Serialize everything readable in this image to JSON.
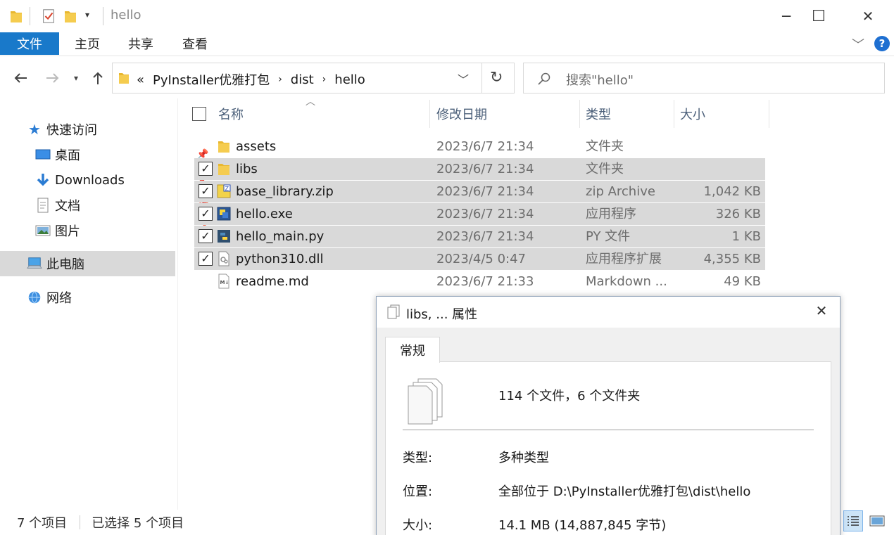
{
  "window": {
    "title": "hello",
    "controls": {
      "minimize": "─",
      "maximize": "☐",
      "close": "✕"
    }
  },
  "ribbon": {
    "tabs": [
      "文件",
      "主页",
      "共享",
      "查看"
    ],
    "help": "?"
  },
  "address": {
    "breadcrumb_prefix": "«",
    "crumbs": [
      "PyInstaller优雅打包",
      "dist",
      "hello"
    ],
    "search_placeholder": "搜索\"hello\""
  },
  "sidebar": {
    "quick_access": "快速访问",
    "items": [
      {
        "label": "桌面",
        "pinned": true
      },
      {
        "label": "Downloads",
        "pinned": true
      },
      {
        "label": "文档",
        "pinned": true
      },
      {
        "label": "图片",
        "pinned": true
      }
    ],
    "this_pc": "此电脑",
    "network": "网络"
  },
  "columns": {
    "name": "名称",
    "modified": "修改日期",
    "type": "类型",
    "size": "大小"
  },
  "files": [
    {
      "name": "assets",
      "modified": "2023/6/7 21:34",
      "type": "文件夹",
      "size": "",
      "selected": false,
      "icon": "folder-icon"
    },
    {
      "name": "libs",
      "modified": "2023/6/7 21:34",
      "type": "文件夹",
      "size": "",
      "selected": true,
      "icon": "folder-icon"
    },
    {
      "name": "base_library.zip",
      "modified": "2023/6/7 21:34",
      "type": "zip Archive",
      "size": "1,042 KB",
      "selected": true,
      "icon": "zip-icon"
    },
    {
      "name": "hello.exe",
      "modified": "2023/6/7 21:34",
      "type": "应用程序",
      "size": "326 KB",
      "selected": true,
      "icon": "exe-icon"
    },
    {
      "name": "hello_main.py",
      "modified": "2023/6/7 21:34",
      "type": "PY 文件",
      "size": "1 KB",
      "selected": true,
      "icon": "python-icon"
    },
    {
      "name": "python310.dll",
      "modified": "2023/4/5 0:47",
      "type": "应用程序扩展",
      "size": "4,355 KB",
      "selected": true,
      "icon": "dll-icon"
    },
    {
      "name": "readme.md",
      "modified": "2023/6/7 21:33",
      "type": "Markdown ...",
      "size": "49 KB",
      "selected": false,
      "icon": "markdown-icon"
    }
  ],
  "status": {
    "count": "7 个项目",
    "selected": "已选择 5 个项目"
  },
  "dialog": {
    "title": "libs, ... 属性",
    "tab": "常规",
    "summary": "114 个文件，6 个文件夹",
    "type_label": "类型:",
    "type_value": "多种类型",
    "location_label": "位置:",
    "location_value": "全部位于 D:\\PyInstaller优雅打包\\dist\\hello",
    "size_label": "大小:",
    "size_value": "14.1 MB (14,887,845 字节)",
    "close": "✕"
  },
  "colors": {
    "accent": "#1979ca",
    "selection": "#d9d9d9",
    "folder": "#e8b730",
    "help": "#1e6fd1"
  }
}
